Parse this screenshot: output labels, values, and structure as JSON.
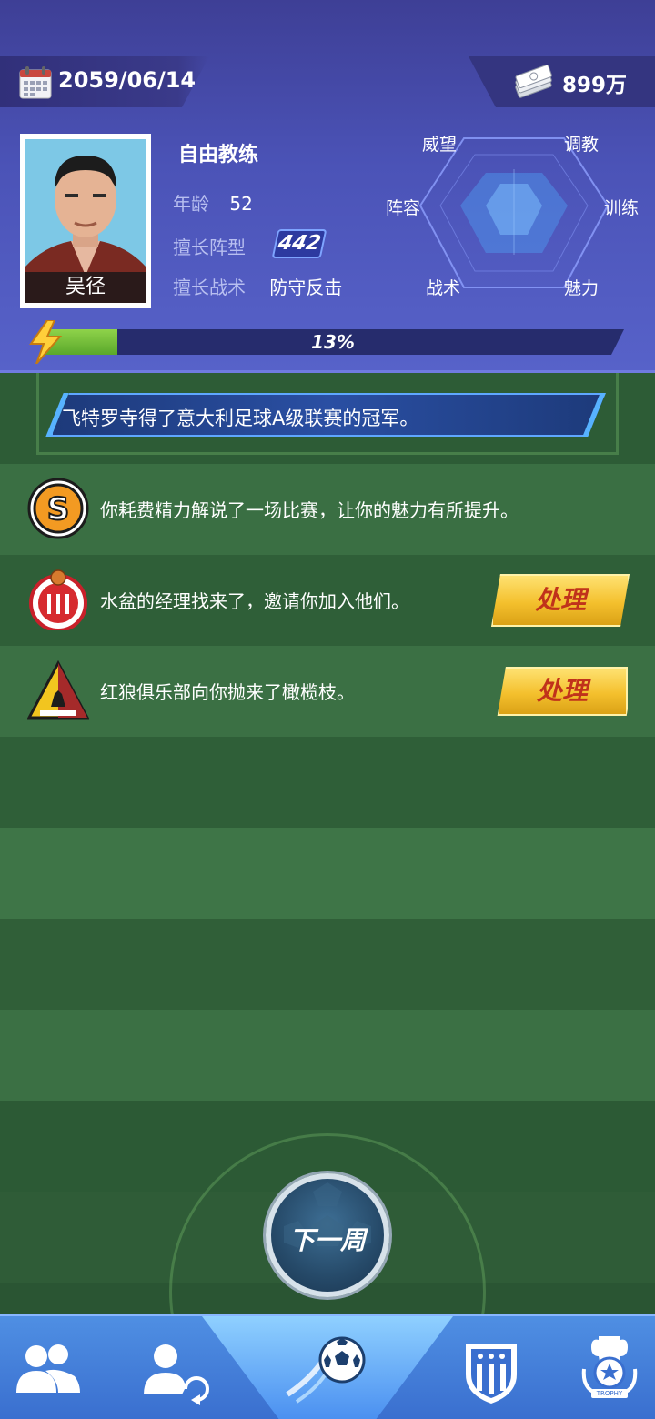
{
  "header": {
    "date": "2059/06/14",
    "money": "899万"
  },
  "coach": {
    "name": "吴径",
    "role": "自由教练",
    "age_label": "年龄",
    "age": "52",
    "formation_label": "擅长阵型",
    "formation": "442",
    "tactic_label": "擅长战术",
    "tactic": "防守反击"
  },
  "radar": {
    "labels": [
      "威望",
      "调教",
      "训练",
      "魅力",
      "战术",
      "阵容"
    ]
  },
  "progress": {
    "percent": 13,
    "label": "13%"
  },
  "news": {
    "ticker": "飞特罗寺得了意大利足球A级联赛的冠军。"
  },
  "events": [
    {
      "icon": "s-coin-icon",
      "text": "你耗费精力解说了一场比赛，让你的魅力有所提升。"
    },
    {
      "icon": "club-crest-icon",
      "text": "水盆的经理找来了，邀请你加入他们。",
      "button": "处理"
    },
    {
      "icon": "wolf-crest-icon",
      "text": "红狼俱乐部向你抛来了橄榄枝。",
      "button": "处理"
    }
  ],
  "next_week_label": "下一周",
  "nav": {
    "items": [
      "team-icon",
      "transfer-icon",
      "match-icon",
      "club-icon",
      "trophy-icon"
    ],
    "trophy_caption": "TROPHY"
  },
  "colors": {
    "header": "#4b53b7",
    "pitch_dark": "#2c5b35",
    "pitch_light": "#3b7044",
    "button_gold": "#f4c02d",
    "nav_blue": "#3a6fcf"
  }
}
